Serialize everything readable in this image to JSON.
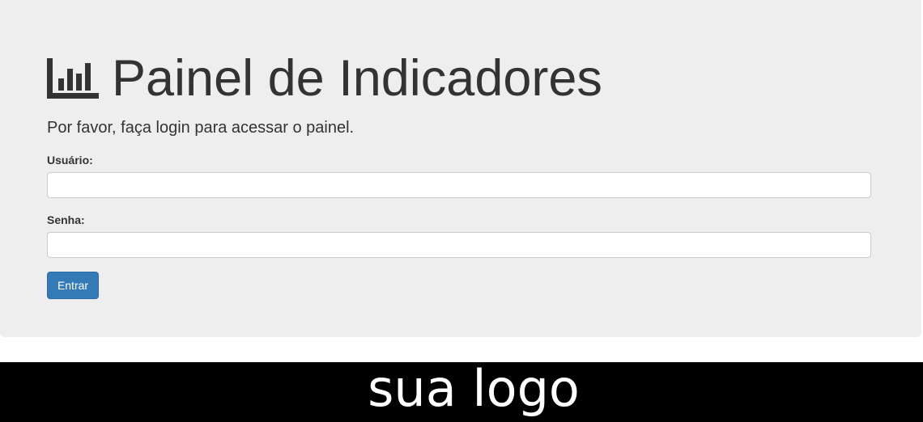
{
  "header": {
    "icon": "bar-chart-icon",
    "title": "Painel de Indicadores",
    "subtitle": "Por favor, faça login para acessar o painel."
  },
  "form": {
    "username_label": "Usuário:",
    "username_value": "",
    "password_label": "Senha:",
    "password_value": "",
    "submit_label": "Entrar"
  },
  "footer": {
    "logo_text": "sua logo"
  },
  "colors": {
    "panel_background": "#eeeeee",
    "primary_button": "#337ab7",
    "footer_background": "#000000"
  }
}
